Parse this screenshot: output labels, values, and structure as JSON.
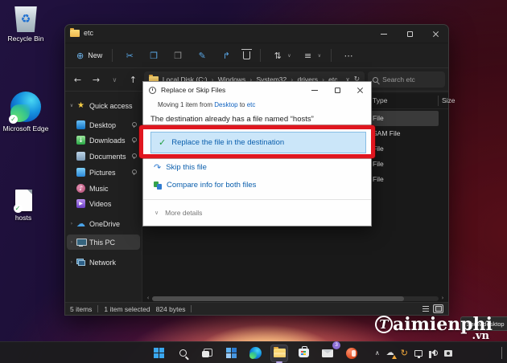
{
  "icons": {
    "plus": "⊕",
    "cut": "✂",
    "copy": "❐",
    "paste": "❒",
    "rename": "✎",
    "share": "↱",
    "sort": "⇅",
    "view": "≡",
    "more": "⋯",
    "back": "←",
    "forward": "→",
    "chev_down": "∨",
    "chev_right": "›",
    "up": "↑",
    "refresh": "↻",
    "star": "★",
    "cloud": "☁",
    "note": "♪",
    "play": "▶",
    "down_arrow": "↓",
    "check": "✓",
    "skip": "↷",
    "recycle": "♻",
    "tray_up": "∧",
    "scroll_left": "‹",
    "scroll_right": "›"
  },
  "colors": {
    "annotation_red": "#e0161f",
    "selected_option_bg": "#cbe6f9",
    "link_blue": "#0f62c0",
    "option_text_blue": "#0b5fad",
    "check_green": "#1e9e3e",
    "accent_blue": "#5aa7e6"
  },
  "desktop": {
    "items": [
      {
        "label": "Recycle Bin"
      },
      {
        "label": "Microsoft Edge"
      },
      {
        "label": "hosts"
      }
    ],
    "watermark": {
      "brand_initial": "T",
      "brand_rest": "aimienphi",
      "tld": ".vn"
    },
    "tooltip": "Show desktop"
  },
  "explorer": {
    "tab_title": "etc",
    "toolbar": {
      "new": "New"
    },
    "breadcrumb": [
      "Local Disk (C:)",
      "Windows",
      "System32",
      "drivers",
      "etc"
    ],
    "search_placeholder": "Search etc",
    "sidebar": [
      {
        "label": "Quick access"
      },
      {
        "label": "Desktop"
      },
      {
        "label": "Downloads"
      },
      {
        "label": "Documents"
      },
      {
        "label": "Pictures"
      },
      {
        "label": "Music"
      },
      {
        "label": "Videos"
      },
      {
        "label": "OneDrive"
      },
      {
        "label": "This PC"
      },
      {
        "label": "Network"
      }
    ],
    "columns": {
      "type": "Type",
      "size": "Size"
    },
    "rows": [
      {
        "type": "File"
      },
      {
        "type": "SAM File"
      },
      {
        "type": "File"
      },
      {
        "type": "File"
      },
      {
        "type": "File"
      }
    ],
    "status": {
      "count": "5 items",
      "selected": "1 item selected",
      "bytes": "824 bytes"
    }
  },
  "dialog": {
    "title": "Replace or Skip Files",
    "subtitle_prefix": "Moving 1 item from ",
    "subtitle_link1": "Desktop",
    "subtitle_mid": " to ",
    "subtitle_link2": "etc",
    "headline": "The destination already has a file named “hosts”",
    "options": [
      {
        "label": "Replace the file in the destination"
      },
      {
        "label": "Skip this file"
      },
      {
        "label": "Compare info for both files"
      }
    ],
    "more": "More details"
  },
  "taskbar": {
    "mail_badge": "3"
  }
}
